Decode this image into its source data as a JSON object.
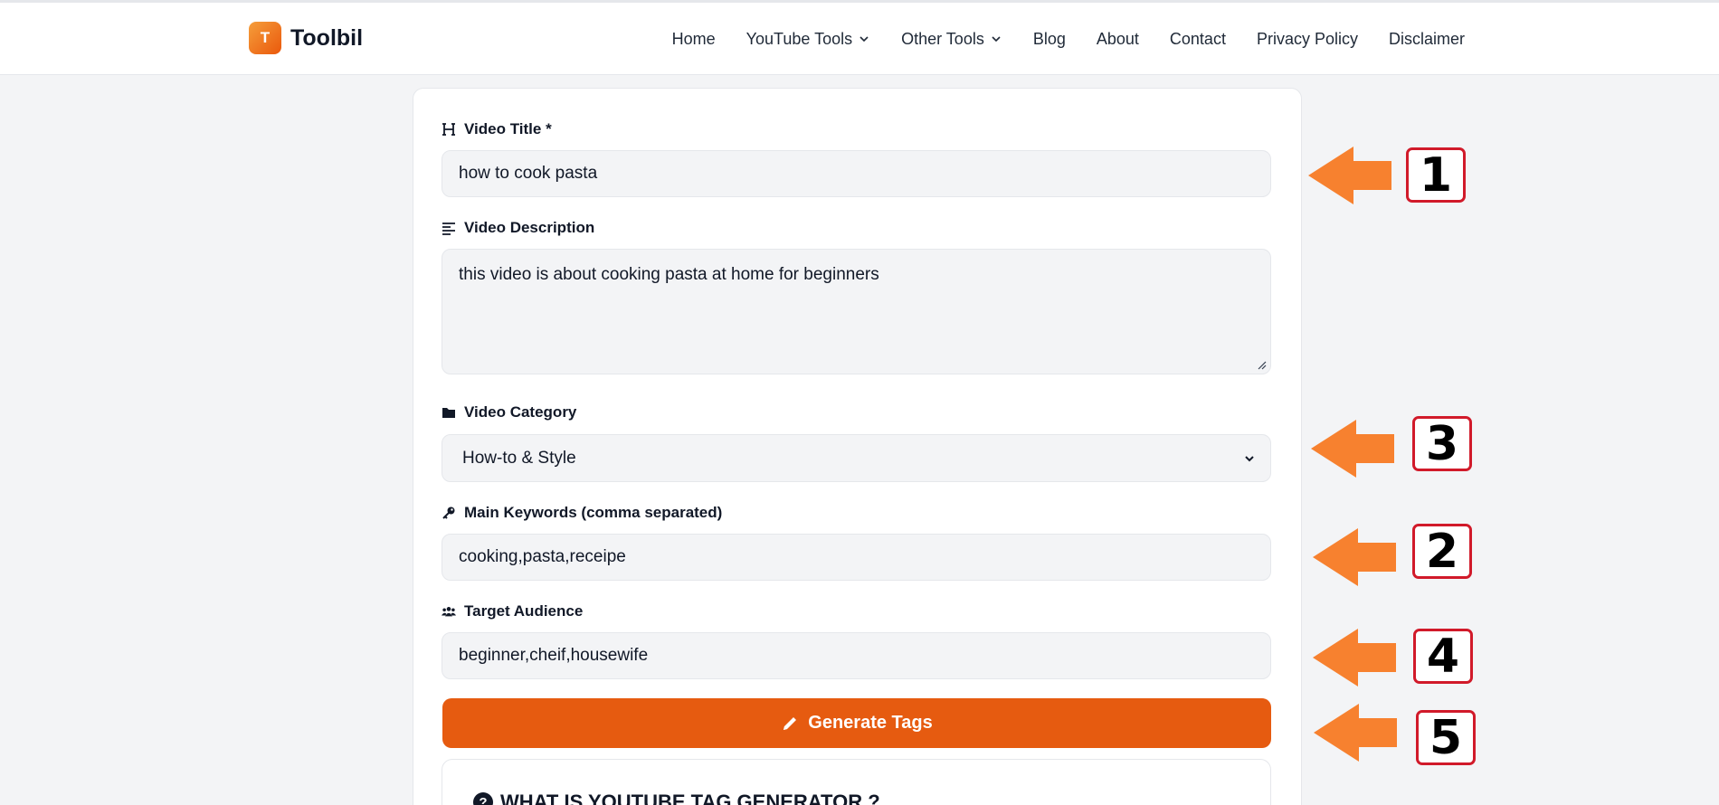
{
  "header": {
    "logo_letter": "T",
    "brand": "Toolbil",
    "nav": [
      {
        "label": "Home",
        "dropdown": false
      },
      {
        "label": "YouTube Tools",
        "dropdown": true
      },
      {
        "label": "Other Tools",
        "dropdown": true
      },
      {
        "label": "Blog",
        "dropdown": false
      },
      {
        "label": "About",
        "dropdown": false
      },
      {
        "label": "Contact",
        "dropdown": false
      },
      {
        "label": "Privacy Policy",
        "dropdown": false
      },
      {
        "label": "Disclaimer",
        "dropdown": false
      }
    ]
  },
  "form": {
    "title": {
      "label": "Video Title *",
      "value": "how to cook pasta",
      "icon": "heading-icon"
    },
    "description": {
      "label": "Video Description",
      "value": "this video is about cooking pasta at home for beginners",
      "icon": "align-left-icon"
    },
    "category": {
      "label": "Video Category",
      "value": "How-to & Style",
      "icon": "folder-icon"
    },
    "keywords": {
      "label": "Main Keywords (comma separated)",
      "value": "cooking,pasta,receipe",
      "icon": "key-icon"
    },
    "audience": {
      "label": "Target Audience",
      "value": "beginner,cheif,housewife",
      "icon": "users-icon"
    },
    "generate_button": "Generate Tags"
  },
  "faq": {
    "title": "WHAT IS YOUTUBE TAG GENERATOR ?"
  },
  "annotations": {
    "arrow_color": "#f7812f",
    "box_border_color": "#d11a2a",
    "labels": [
      "1",
      "3",
      "2",
      "4",
      "5"
    ]
  },
  "colors": {
    "accent": "#e65b10",
    "input_bg": "#f3f4f6"
  }
}
